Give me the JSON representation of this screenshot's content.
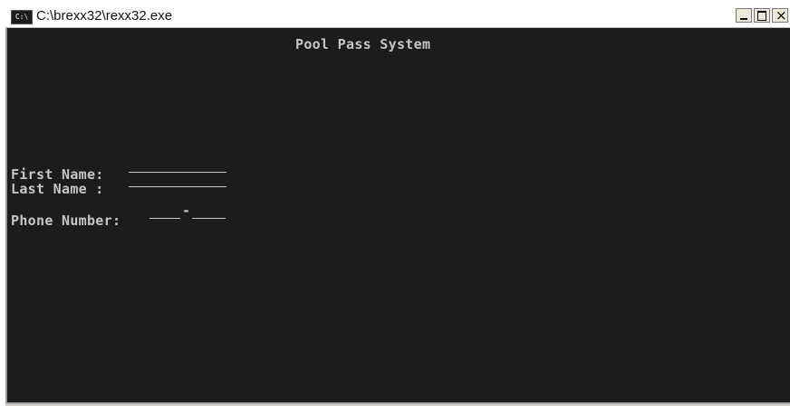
{
  "window": {
    "title": "C:\\brexx32\\rexx32.exe",
    "icon_label": "C:\\",
    "controls": {
      "minimize": "minimize",
      "maximize": "maximize",
      "close": "close"
    }
  },
  "console": {
    "heading": "Pool Pass System",
    "first_name_label": "First Name:",
    "last_name_label": "Last Name :",
    "phone_label": "Phone Number:",
    "phone_separator": "-",
    "text_color": "#c6c6c6",
    "background_color": "#1c1c1c"
  }
}
